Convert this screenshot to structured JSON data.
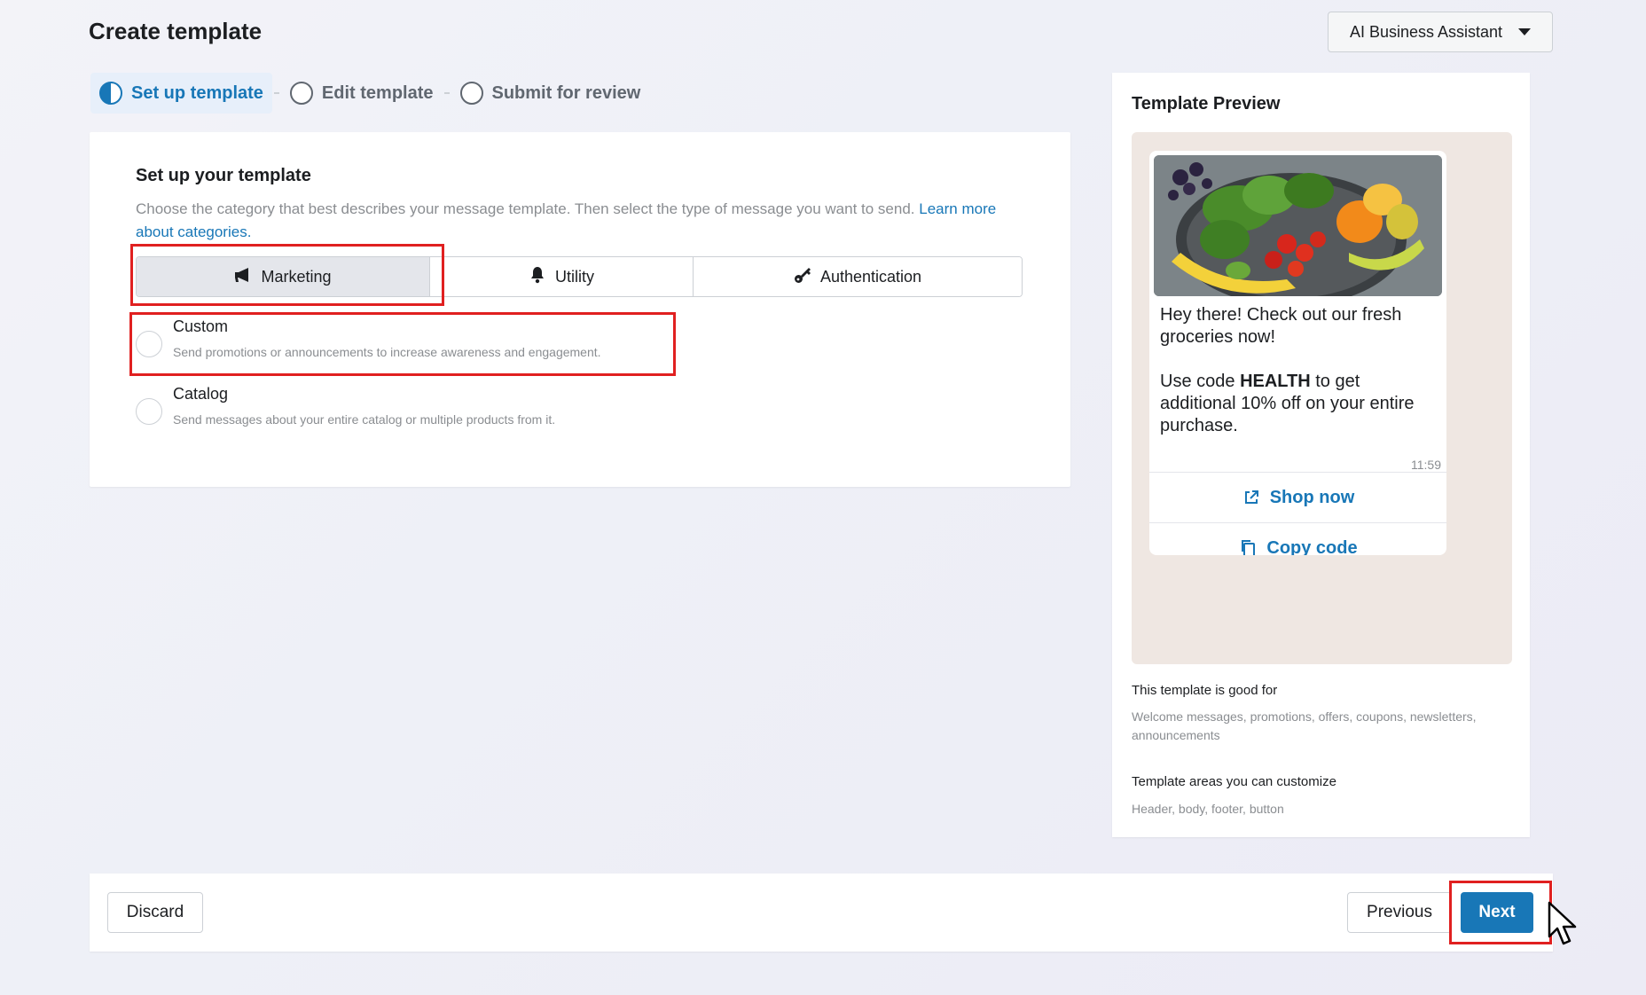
{
  "header": {
    "title": "Create template",
    "assistant_label": "AI Business Assistant"
  },
  "steps": [
    {
      "label": "Set up template",
      "state": "active"
    },
    {
      "label": "Edit template",
      "state": "pending"
    },
    {
      "label": "Submit for review",
      "state": "pending"
    }
  ],
  "setup": {
    "title": "Set up your template",
    "description": "Choose the category that best describes your message template. Then select the type of message you want to send. ",
    "learn_more": "Learn more about categories.",
    "tabs": [
      {
        "label": "Marketing",
        "icon": "megaphone-icon",
        "selected": true
      },
      {
        "label": "Utility",
        "icon": "bell-icon",
        "selected": false
      },
      {
        "label": "Authentication",
        "icon": "key-icon",
        "selected": false
      }
    ],
    "options": [
      {
        "label": "Custom",
        "description": "Send promotions or announcements to increase awareness and engagement."
      },
      {
        "label": "Catalog",
        "description": "Send messages about your entire catalog or multiple products from it."
      }
    ]
  },
  "preview": {
    "title": "Template Preview",
    "message_line1": "Hey there! Check out our fresh groceries now!",
    "message_pre": "Use code ",
    "message_code": "HEALTH",
    "message_post": " to get additional 10% off on your entire purchase.",
    "time": "11:59",
    "button1": "Shop now",
    "button2": "Copy code",
    "good_for_label": "This template is good for",
    "good_for": "Welcome messages, promotions, offers, coupons, newsletters, announcements",
    "areas_label": "Template areas you can customize",
    "areas": "Header, body, footer, button"
  },
  "footer": {
    "discard": "Discard",
    "previous": "Previous",
    "next": "Next"
  },
  "colors": {
    "accent": "#1877b7",
    "highlight": "#e02020"
  }
}
